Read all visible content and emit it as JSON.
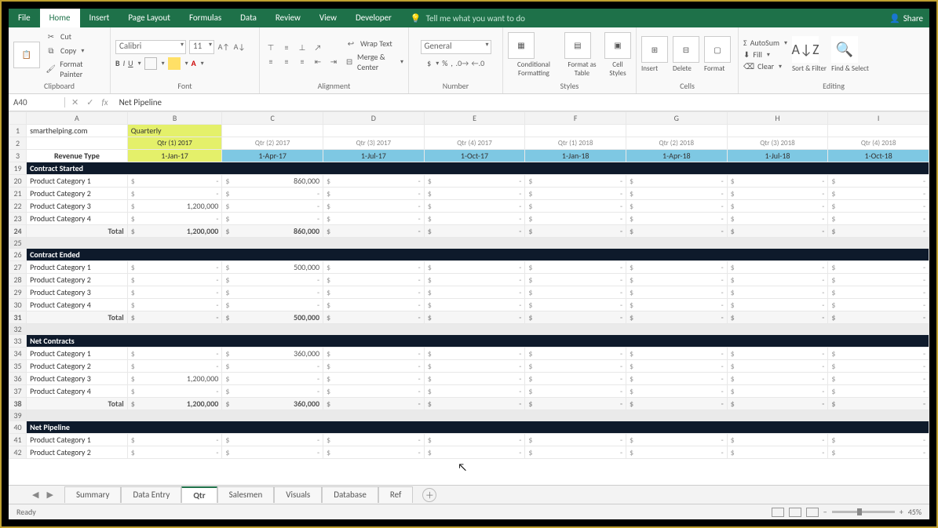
{
  "menu": {
    "tabs": [
      "File",
      "Home",
      "Insert",
      "Page Layout",
      "Formulas",
      "Data",
      "Review",
      "View",
      "Developer"
    ],
    "active": 1,
    "tell_me": "Tell me what you want to do",
    "share": "Share"
  },
  "ribbon": {
    "clipboard": {
      "label": "Clipboard",
      "cut": "Cut",
      "copy": "Copy",
      "painter": "Format Painter",
      "paste": "Paste"
    },
    "font": {
      "label": "Font",
      "name": "Calibri",
      "size": "11"
    },
    "alignment": {
      "label": "Alignment",
      "wrap": "Wrap Text",
      "merge": "Merge & Center"
    },
    "number": {
      "label": "Number",
      "format": "General"
    },
    "styles": {
      "label": "Styles",
      "cond": "Conditional Formatting",
      "table": "Format as Table",
      "cell": "Cell Styles"
    },
    "cells": {
      "label": "Cells",
      "insert": "Insert",
      "delete": "Delete",
      "format": "Format"
    },
    "editing": {
      "label": "Editing",
      "autosum": "AutoSum",
      "fill": "Fill",
      "clear": "Clear",
      "sort": "Sort & Filter",
      "find": "Find & Select"
    }
  },
  "namebox": "A40",
  "formula": "Net Pipeline",
  "columns": [
    "A",
    "B",
    "C",
    "D",
    "E",
    "F",
    "G",
    "H",
    "I"
  ],
  "headers": {
    "site": "smarthelping.com",
    "quarterly": "Quarterly",
    "quarters": [
      "Qtr (1) 2017",
      "Qtr (2) 2017",
      "Qtr (3) 2017",
      "Qtr (4) 2017",
      "Qtr (1) 2018",
      "Qtr (2) 2018",
      "Qtr (3) 2018",
      "Qtr (4) 2018"
    ],
    "revtype": "Revenue Type",
    "dates": [
      "1-Jan-17",
      "1-Apr-17",
      "1-Jul-17",
      "1-Oct-17",
      "1-Jan-18",
      "1-Apr-18",
      "1-Jul-18",
      "1-Oct-18"
    ]
  },
  "sections": [
    {
      "row": 19,
      "title": "Contract Started",
      "items": [
        {
          "row": 20,
          "label": "Product Category 1",
          "B": "",
          "C": "860,000"
        },
        {
          "row": 21,
          "label": "Product Category 2",
          "B": "",
          "C": ""
        },
        {
          "row": 22,
          "label": "Product Category 3",
          "B": "1,200,000",
          "C": ""
        },
        {
          "row": 23,
          "label": "Product Category 4",
          "B": "",
          "C": ""
        }
      ],
      "total": {
        "row": 24,
        "label": "Total",
        "B": "1,200,000",
        "C": "860,000"
      }
    },
    {
      "row": 26,
      "title": "Contract Ended",
      "items": [
        {
          "row": 27,
          "label": "Product Category 1",
          "B": "",
          "C": "500,000"
        },
        {
          "row": 28,
          "label": "Product Category 2",
          "B": "",
          "C": ""
        },
        {
          "row": 29,
          "label": "Product Category 3",
          "B": "",
          "C": ""
        },
        {
          "row": 30,
          "label": "Product Category 4",
          "B": "",
          "C": ""
        }
      ],
      "total": {
        "row": 31,
        "label": "Total",
        "B": "",
        "C": "500,000"
      }
    },
    {
      "row": 33,
      "title": "Net Contracts",
      "items": [
        {
          "row": 34,
          "label": "Product Category 1",
          "B": "",
          "C": "360,000"
        },
        {
          "row": 35,
          "label": "Product Category 2",
          "B": "",
          "C": ""
        },
        {
          "row": 36,
          "label": "Product Category 3",
          "B": "1,200,000",
          "C": ""
        },
        {
          "row": 37,
          "label": "Product Category 4",
          "B": "",
          "C": ""
        }
      ],
      "total": {
        "row": 38,
        "label": "Total",
        "B": "1,200,000",
        "C": "360,000"
      }
    },
    {
      "row": 40,
      "title": "Net Pipeline",
      "items": [
        {
          "row": 41,
          "label": "Product Category 1",
          "B": "",
          "C": ""
        },
        {
          "row": 42,
          "label": "Product Category 2",
          "B": "",
          "C": ""
        }
      ]
    }
  ],
  "sheets": {
    "tabs": [
      "Summary",
      "Data Entry",
      "Qtr",
      "Salesmen",
      "Visuals",
      "Database",
      "Ref"
    ],
    "active": 2
  },
  "status": {
    "ready": "Ready",
    "zoom": "45%",
    "minus": "−",
    "plus": "+"
  }
}
